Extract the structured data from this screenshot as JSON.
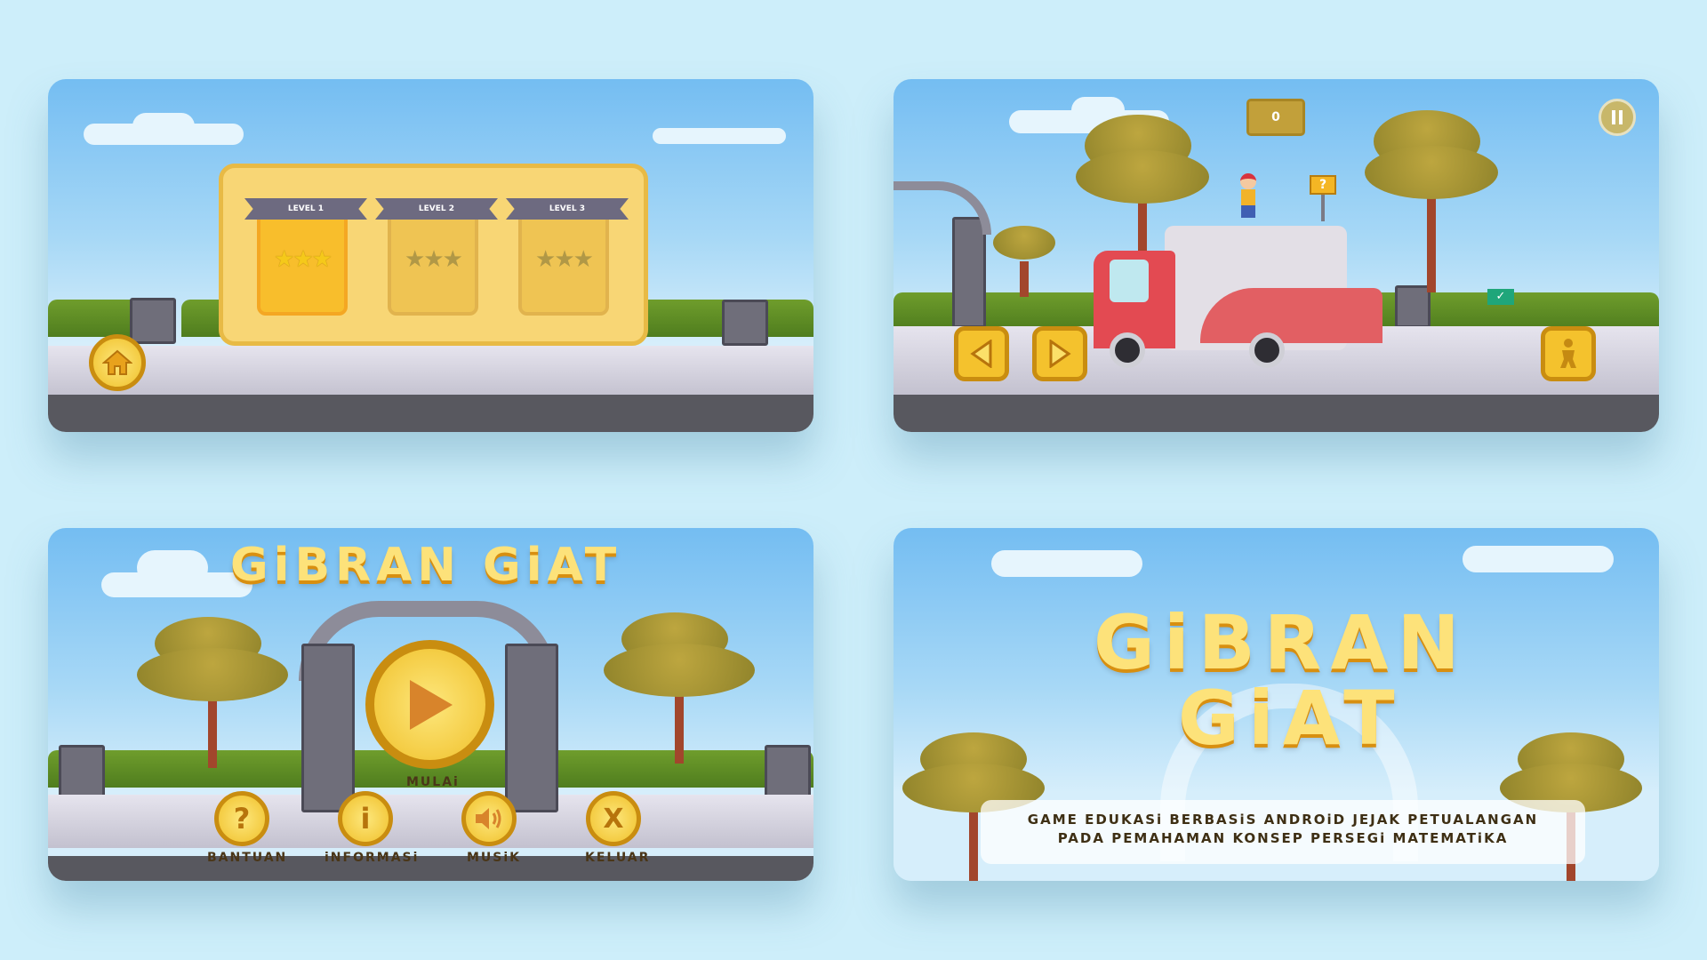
{
  "level_select": {
    "levels": [
      {
        "label": "LEVEL 1",
        "stars": "★★★"
      },
      {
        "label": "LEVEL 2",
        "stars": "★★★"
      },
      {
        "label": "LEVEL 3",
        "stars": "★★★"
      }
    ],
    "home_icon": "home-icon"
  },
  "gameplay": {
    "score": "0",
    "question_sign": "?",
    "pause_icon": "pause-icon",
    "controls": [
      "left-arrow-icon",
      "right-arrow-icon",
      "jump-icon"
    ]
  },
  "main_menu": {
    "title": "GiBRAN GiAT",
    "play_label": "MULAi",
    "buttons": [
      {
        "label": "BANTUAN",
        "glyph": "?"
      },
      {
        "label": "iNFORMASi",
        "glyph": "i"
      },
      {
        "label": "MUSiK",
        "glyph": "🔊"
      },
      {
        "label": "KELUAR",
        "glyph": "X"
      }
    ]
  },
  "splash": {
    "title_line1": "GiBRAN",
    "title_line2": "GiAT",
    "tagline_line1": "GAME EDUKASi BERBASiS ANDROiD JEJAK PETUALANGAN",
    "tagline_line2": "PADA PEMAHAMAN KONSEP PERSEGi MATEMATiKA"
  },
  "colors": {
    "background": "#cdeefa",
    "accent": "#f4c22d",
    "title": "#fde27a"
  }
}
